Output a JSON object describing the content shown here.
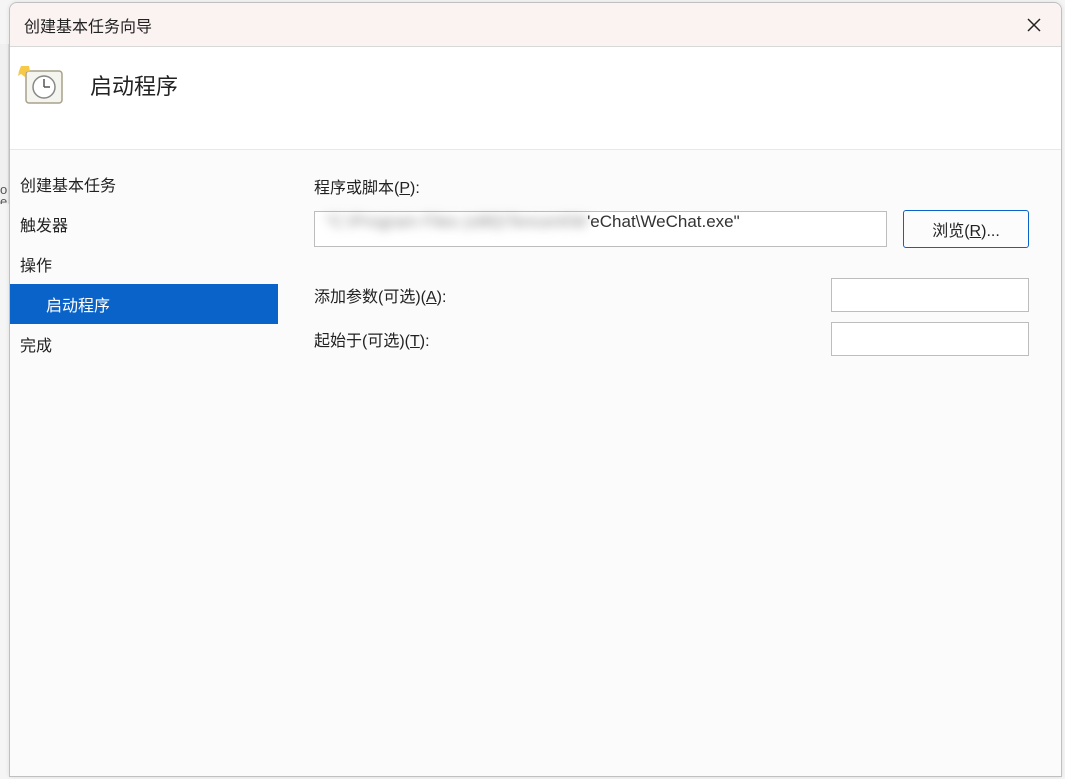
{
  "window": {
    "title": "创建基本任务向导",
    "heading": "启动程序"
  },
  "sidebar": {
    "items": [
      {
        "label": "创建基本任务",
        "active": false
      },
      {
        "label": "触发器",
        "active": false
      },
      {
        "label": "操作",
        "active": false
      },
      {
        "label": "启动程序",
        "active": true
      },
      {
        "label": "完成",
        "active": false
      }
    ]
  },
  "form": {
    "program_label_prefix": "程序或脚本(",
    "program_label_key": "P",
    "program_label_suffix": "):",
    "program_value_visible": "'eChat\\WeChat.exe\"",
    "browse_label_prefix": "浏览(",
    "browse_label_key": "R",
    "browse_label_suffix": ")...",
    "args_label_prefix": "添加参数(可选)(",
    "args_label_key": "A",
    "args_label_suffix": "):",
    "args_value": "",
    "startin_label_prefix": "起始于(可选)(",
    "startin_label_key": "T",
    "startin_label_suffix": "):",
    "startin_value": ""
  }
}
